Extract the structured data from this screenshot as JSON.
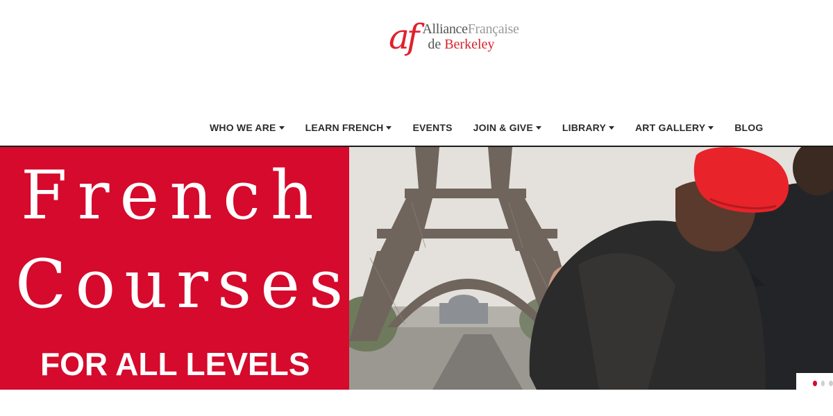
{
  "logo": {
    "mark": "af",
    "line1_part1": "Alliance",
    "line1_part2": "Française",
    "line2_part1": "de",
    "line2_part2": "Berkeley"
  },
  "nav": {
    "items": [
      {
        "label": "WHO WE ARE",
        "dropdown": true
      },
      {
        "label": "LEARN FRENCH",
        "dropdown": true
      },
      {
        "label": "EVENTS",
        "dropdown": false
      },
      {
        "label": "JOIN & GIVE",
        "dropdown": true
      },
      {
        "label": "LIBRARY",
        "dropdown": true
      },
      {
        "label": "ART GALLERY",
        "dropdown": true
      },
      {
        "label": "BLOG",
        "dropdown": false
      }
    ]
  },
  "hero": {
    "title_line1": "French",
    "title_line2": "Courses",
    "subtitle": "FOR ALL LEVELS",
    "accent_color": "#d50a2c",
    "active_slide": 1,
    "slide_count": 3
  }
}
